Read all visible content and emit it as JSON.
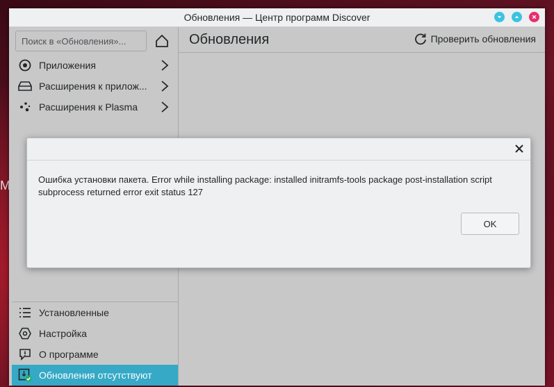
{
  "window": {
    "title": "Обновления — Центр программ Discover"
  },
  "desktop": {
    "partial_text": "M"
  },
  "search": {
    "placeholder": "Поиск в «Обновления»..."
  },
  "categories": [
    {
      "label": "Приложения",
      "icon": "applications-icon"
    },
    {
      "label": "Расширения к прилож...",
      "icon": "addons-icon"
    },
    {
      "label": "Расширения к Plasma",
      "icon": "plasma-icon"
    }
  ],
  "bottom_nav": [
    {
      "label": "Установленные",
      "icon": "list-icon"
    },
    {
      "label": "Настройка",
      "icon": "settings-icon"
    },
    {
      "label": "О программе",
      "icon": "about-icon"
    },
    {
      "label": "Обновления отсутствуют",
      "icon": "updates-ok-icon",
      "active": true
    }
  ],
  "header": {
    "title": "Обновления",
    "check_updates_label": "Проверить обновления"
  },
  "dialog": {
    "message": "Ошибка установки пакета. Error while installing package: installed initramfs-tools package post-installation script subprocess returned error exit status 127",
    "ok_label": "OK"
  },
  "colors": {
    "accent": "#35a9c6",
    "close": "#e7306b",
    "window_bg": "#c8c8c9",
    "dialog_bg": "#eff0f1"
  }
}
